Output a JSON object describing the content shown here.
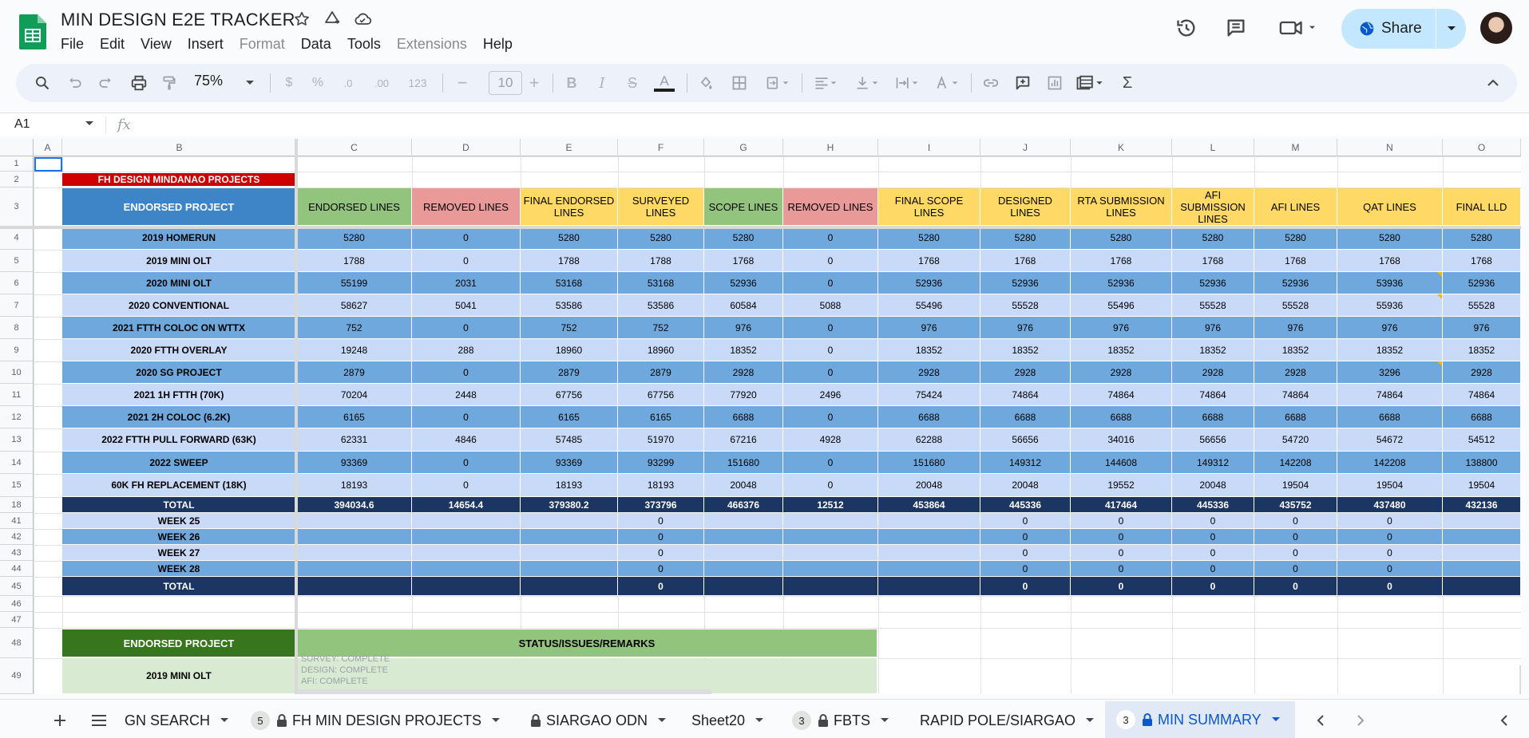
{
  "app": {
    "title": "MIN DESIGN E2E TRACKER",
    "menu": [
      {
        "label": "File",
        "dim": false
      },
      {
        "label": "Edit",
        "dim": false
      },
      {
        "label": "View",
        "dim": false
      },
      {
        "label": "Insert",
        "dim": false
      },
      {
        "label": "Format",
        "dim": true
      },
      {
        "label": "Data",
        "dim": false
      },
      {
        "label": "Tools",
        "dim": false
      },
      {
        "label": "Extensions",
        "dim": true
      },
      {
        "label": "Help",
        "dim": false
      }
    ],
    "share_label": "Share"
  },
  "toolbar": {
    "zoom": "75%",
    "currency": "$",
    "percent": "%",
    "dec_decrease": ".0",
    "dec_increase": ".00",
    "number_format": "123",
    "font_size": "10",
    "minus": "−",
    "plus": "+",
    "bold": "B",
    "italic": "I",
    "strike": "S",
    "text_color": "A",
    "sum": "Σ"
  },
  "formula_bar": {
    "cell_ref": "A1",
    "fx": "fx",
    "value": ""
  },
  "grid": {
    "columns": [
      "A",
      "B",
      "C",
      "D",
      "E",
      "F",
      "G",
      "H",
      "I",
      "J",
      "K",
      "L",
      "M",
      "N",
      "O"
    ],
    "row_numbers": [
      "1",
      "2",
      "3",
      "4",
      "5",
      "6",
      "7",
      "8",
      "9",
      "10",
      "11",
      "12",
      "13",
      "14",
      "15",
      "18",
      "41",
      "42",
      "43",
      "44",
      "45",
      "46",
      "47",
      "48",
      "49"
    ],
    "banner": "FH DESIGN MINDANAO PROJECTS",
    "header_first": "ENDORSED PROJECT",
    "headers": [
      "ENDORSED LINES",
      "REMOVED LINES",
      "FINAL ENDORSED LINES",
      "SURVEYED LINES",
      "SCOPE LINES",
      "REMOVED LINES",
      "FINAL SCOPE LINES",
      "DESIGNED LINES",
      "RTA SUBMISSION LINES",
      "AFI SUBMISSION LINES",
      "AFI LINES",
      "QAT LINES",
      "FINAL LLD"
    ],
    "header_colors": [
      "#93c47d",
      "#ea9999",
      "#ffd966",
      "#ffd966",
      "#93c47d",
      "#ea9999",
      "#ffd966",
      "#ffd966",
      "#ffd966",
      "#ffd966",
      "#ffd966",
      "#ffd966",
      "#ffd966"
    ],
    "projects": [
      {
        "name": "2019 HOMERUN",
        "values": [
          "5280",
          "0",
          "5280",
          "5280",
          "5280",
          "0",
          "5280",
          "5280",
          "5280",
          "5280",
          "5280",
          "5280",
          "5280"
        ]
      },
      {
        "name": "2019 MINI OLT",
        "values": [
          "1788",
          "0",
          "1788",
          "1788",
          "1768",
          "0",
          "1768",
          "1768",
          "1768",
          "1768",
          "1768",
          "1768",
          "1768"
        ]
      },
      {
        "name": "2020 MINI OLT",
        "values": [
          "55199",
          "2031",
          "53168",
          "53168",
          "52936",
          "0",
          "52936",
          "52936",
          "52936",
          "52936",
          "52936",
          "53936",
          "52936"
        ]
      },
      {
        "name": "2020 CONVENTIONAL",
        "values": [
          "58627",
          "5041",
          "53586",
          "53586",
          "60584",
          "5088",
          "55496",
          "55528",
          "55496",
          "55528",
          "55528",
          "55936",
          "55528"
        ]
      },
      {
        "name": "2021 FTTH COLOC ON WTTX",
        "values": [
          "752",
          "0",
          "752",
          "752",
          "976",
          "0",
          "976",
          "976",
          "976",
          "976",
          "976",
          "976",
          "976"
        ]
      },
      {
        "name": "2020 FTTH OVERLAY",
        "values": [
          "19248",
          "288",
          "18960",
          "18960",
          "18352",
          "0",
          "18352",
          "18352",
          "18352",
          "18352",
          "18352",
          "18352",
          "18352"
        ]
      },
      {
        "name": "2020 SG PROJECT",
        "values": [
          "2879",
          "0",
          "2879",
          "2879",
          "2928",
          "0",
          "2928",
          "2928",
          "2928",
          "2928",
          "2928",
          "3296",
          "2928"
        ]
      },
      {
        "name": "2021 1H FTTH (70K)",
        "values": [
          "70204",
          "2448",
          "67756",
          "67756",
          "77920",
          "2496",
          "75424",
          "74864",
          "74864",
          "74864",
          "74864",
          "74864",
          "74864"
        ]
      },
      {
        "name": "2021 2H COLOC (6.2K)",
        "values": [
          "6165",
          "0",
          "6165",
          "6165",
          "6688",
          "0",
          "6688",
          "6688",
          "6688",
          "6688",
          "6688",
          "6688",
          "6688"
        ]
      },
      {
        "name": "2022 FTTH PULL FORWARD (63K)",
        "values": [
          "62331",
          "4846",
          "57485",
          "51970",
          "67216",
          "4928",
          "62288",
          "56656",
          "34016",
          "56656",
          "54720",
          "54672",
          "54512"
        ]
      },
      {
        "name": "2022 SWEEP",
        "values": [
          "93369",
          "0",
          "93369",
          "93299",
          "151680",
          "0",
          "151680",
          "149312",
          "144608",
          "149312",
          "142208",
          "142208",
          "138800"
        ]
      },
      {
        "name": "60K FH REPLACEMENT (18K)",
        "values": [
          "18193",
          "0",
          "18193",
          "18193",
          "20048",
          "0",
          "20048",
          "20048",
          "19552",
          "20048",
          "19504",
          "19504",
          "19504"
        ]
      }
    ],
    "total": {
      "name": "TOTAL",
      "values": [
        "394034.6",
        "14654.4",
        "379380.2",
        "373796",
        "466376",
        "12512",
        "453864",
        "445336",
        "417464",
        "445336",
        "435752",
        "437480",
        "432136"
      ]
    },
    "weeks": [
      {
        "name": "WEEK 25",
        "values": [
          "",
          "",
          "",
          "0",
          "",
          "",
          "",
          "0",
          "0",
          "0",
          "0",
          "0",
          ""
        ]
      },
      {
        "name": "WEEK 26",
        "values": [
          "",
          "",
          "",
          "0",
          "",
          "",
          "",
          "0",
          "0",
          "0",
          "0",
          "0",
          ""
        ]
      },
      {
        "name": "WEEK 27",
        "values": [
          "",
          "",
          "",
          "0",
          "",
          "",
          "",
          "0",
          "0",
          "0",
          "0",
          "0",
          ""
        ]
      },
      {
        "name": "WEEK 28",
        "values": [
          "",
          "",
          "",
          "0",
          "",
          "",
          "",
          "0",
          "0",
          "0",
          "0",
          "0",
          ""
        ]
      }
    ],
    "week_total": {
      "name": "TOTAL",
      "values": [
        "",
        "",
        "",
        "0",
        "",
        "",
        "",
        "0",
        "0",
        "0",
        "0",
        "0",
        ""
      ]
    },
    "status_section": {
      "header_first": "ENDORSED PROJECT",
      "header_remarks": "STATUS/ISSUES/REMARKS",
      "project": "2019 MINI OLT",
      "remarks": [
        "SURVEY: COMPLETE",
        "DESIGN: COMPLETE",
        "AFI: COMPLETE"
      ]
    }
  },
  "sheet_tabs": [
    {
      "label": "GN SEARCH",
      "count": "",
      "locked": false,
      "active": false
    },
    {
      "label": "FH MIN DESIGN PROJECTS",
      "count": "5",
      "locked": true,
      "active": false
    },
    {
      "label": "SIARGAO ODN",
      "count": "",
      "locked": true,
      "active": false
    },
    {
      "label": "Sheet20",
      "count": "",
      "locked": false,
      "active": false
    },
    {
      "label": "FBTS",
      "count": "3",
      "locked": true,
      "active": false
    },
    {
      "label": "RAPID POLE/SIARGAO",
      "count": "",
      "locked": false,
      "active": false
    },
    {
      "label": "MIN SUMMARY",
      "count": "3",
      "locked": true,
      "active": true
    }
  ],
  "colors": {
    "banner_red": "#cc0000",
    "header_blue": "#3d85c6",
    "row_dark": "#6fa8dc",
    "row_light": "#c9daf8",
    "total_navy": "#1c3664",
    "status_green_dark": "#38761d",
    "status_green": "#93c47d",
    "status_green_light": "#d9ead3",
    "accent": "#0b57d0"
  }
}
